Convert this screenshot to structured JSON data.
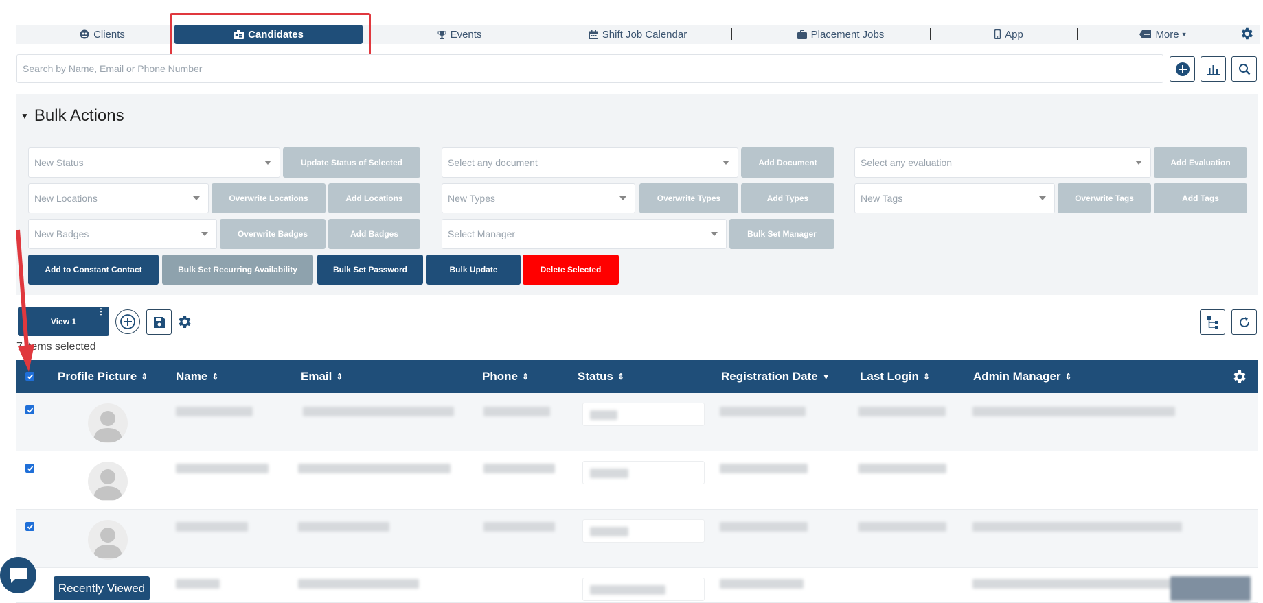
{
  "nav": {
    "items": [
      {
        "label": "Clients",
        "icon": "users-icon"
      },
      {
        "label": "Candidates",
        "icon": "id-card-icon",
        "active": true
      },
      {
        "label": "Events",
        "icon": "trophy-icon"
      },
      {
        "label": "Shift Job Calendar",
        "icon": "calendar-icon"
      },
      {
        "label": "Placement Jobs",
        "icon": "briefcase-icon"
      },
      {
        "label": "App",
        "icon": "mobile-icon"
      },
      {
        "label": "More",
        "icon": "ellipsis-badge-icon"
      }
    ]
  },
  "search": {
    "placeholder": "Search by Name, Email or Phone Number"
  },
  "bulk": {
    "title": "Bulk Actions",
    "new_status_placeholder": "New Status",
    "update_status_label": "Update Status of Selected",
    "select_document_placeholder": "Select any document",
    "add_document_label": "Add Document",
    "select_evaluation_placeholder": "Select any evaluation",
    "add_evaluation_label": "Add Evaluation",
    "new_locations_placeholder": "New Locations",
    "overwrite_locations_label": "Overwrite Locations",
    "add_locations_label": "Add Locations",
    "new_types_placeholder": "New Types",
    "overwrite_types_label": "Overwrite Types",
    "add_types_label": "Add Types",
    "new_tags_placeholder": "New Tags",
    "overwrite_tags_label": "Overwrite Tags",
    "add_tags_label": "Add Tags",
    "new_badges_placeholder": "New Badges",
    "overwrite_badges_label": "Overwrite Badges",
    "add_badges_label": "Add Badges",
    "select_manager_placeholder": "Select Manager",
    "bulk_set_manager_label": "Bulk Set Manager",
    "add_constant_contact_label": "Add to Constant Contact",
    "bulk_recurring_label": "Bulk Set Recurring Availability",
    "bulk_password_label": "Bulk Set Password",
    "bulk_update_label": "Bulk Update",
    "delete_selected_label": "Delete Selected"
  },
  "view": {
    "tab_label": "View 1",
    "items_selected": "7 items selected"
  },
  "table": {
    "headers": [
      "Profile Picture",
      "Name",
      "Email",
      "Phone",
      "Status",
      "Registration Date",
      "Last Login",
      "Admin Manager"
    ]
  },
  "footer": {
    "recently_viewed": "Recently Viewed"
  },
  "colors": {
    "primary": "#1f4e79",
    "disabled": "#b8c5cc",
    "danger": "#ff0000",
    "highlight": "#e0383e"
  }
}
